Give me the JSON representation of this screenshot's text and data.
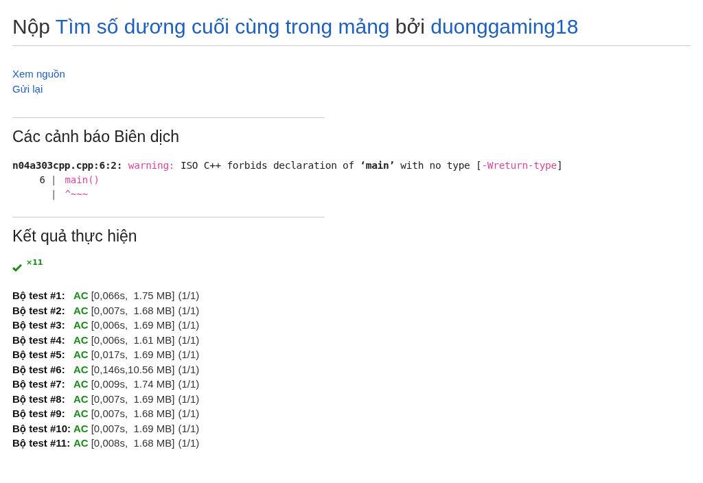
{
  "heading": {
    "prefix": "Nộp",
    "problem": "Tìm số dương cuối cùng trong mảng",
    "middle": "bởi",
    "user": "duonggaming18"
  },
  "links": [
    "Xem nguồn",
    "Gửi lại"
  ],
  "warnings_section": {
    "title": "Các cảnh báo Biên dịch",
    "message": [
      {
        "kind": "location",
        "text": "n04a303cpp.cpp:6:2:"
      },
      {
        "kind": "severity",
        "text": "warning:"
      },
      {
        "kind": "plain",
        "text": "ISO C++ forbids declaration of **‘main’** with no type ["
      },
      {
        "kind": "flag",
        "text": "-Wreturn-type"
      },
      {
        "kind": "plain",
        "text": "]"
      }
    ],
    "code_lines": [
      {
        "number": "6",
        "bar": "|",
        "code": "main()"
      },
      {
        "bar": "|",
        "code": "^~~~"
      }
    ]
  },
  "results_section": {
    "title": "Kết quả thực hiện",
    "summary_count": "×11",
    "tests": [
      {
        "label": "Bộ test #1:",
        "verdict": "AC",
        "time": "[0,066s,",
        "memory": "1.75 MB]",
        "points": "(1/1)"
      },
      {
        "label": "Bộ test #2:",
        "verdict": "AC",
        "time": "[0,007s,",
        "memory": "1.68 MB]",
        "points": "(1/1)"
      },
      {
        "label": "Bộ test #3:",
        "verdict": "AC",
        "time": "[0,006s,",
        "memory": "1.69 MB]",
        "points": "(1/1)"
      },
      {
        "label": "Bộ test #4:",
        "verdict": "AC",
        "time": "[0,006s,",
        "memory": "1.61 MB]",
        "points": "(1/1)"
      },
      {
        "label": "Bộ test #5:",
        "verdict": "AC",
        "time": "[0,017s,",
        "memory": "1.69 MB]",
        "points": "(1/1)"
      },
      {
        "label": "Bộ test #6:",
        "verdict": "AC",
        "time": "[0,146s,",
        "memory": "10.56 MB]",
        "points": "(1/1)"
      },
      {
        "label": "Bộ test #7:",
        "verdict": "AC",
        "time": "[0,009s,",
        "memory": "1.74 MB]",
        "points": "(1/1)"
      },
      {
        "label": "Bộ test #8:",
        "verdict": "AC",
        "time": "[0,007s,",
        "memory": "1.69 MB]",
        "points": "(1/1)"
      },
      {
        "label": "Bộ test #9:",
        "verdict": "AC",
        "time": "[0,007s,",
        "memory": "1.68 MB]",
        "points": "(1/1)"
      },
      {
        "label": "Bộ test #10:",
        "verdict": "AC",
        "time": "[0,007s,",
        "memory": "1.69 MB]",
        "points": "(1/1)"
      },
      {
        "label": "Bộ test #11:",
        "verdict": "AC",
        "time": "[0,008s,",
        "memory": "1.68 MB]",
        "points": "(1/1)"
      }
    ]
  }
}
